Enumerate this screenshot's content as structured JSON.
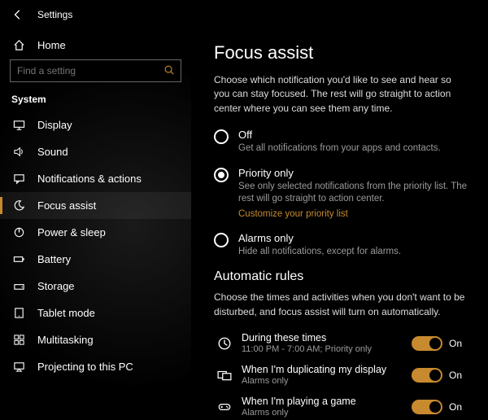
{
  "header": {
    "title": "Settings"
  },
  "sidebar": {
    "home_label": "Home",
    "search_placeholder": "Find a setting",
    "section_label": "System",
    "items": [
      {
        "label": "Display"
      },
      {
        "label": "Sound"
      },
      {
        "label": "Notifications & actions"
      },
      {
        "label": "Focus assist"
      },
      {
        "label": "Power & sleep"
      },
      {
        "label": "Battery"
      },
      {
        "label": "Storage"
      },
      {
        "label": "Tablet mode"
      },
      {
        "label": "Multitasking"
      },
      {
        "label": "Projecting to this PC"
      }
    ]
  },
  "main": {
    "title": "Focus assist",
    "description": "Choose which notification you'd like to see and hear so you can stay focused. The rest will go straight to action center where you can see them any time.",
    "options": [
      {
        "title": "Off",
        "sub": "Get all notifications from your apps and contacts."
      },
      {
        "title": "Priority only",
        "sub": "See only selected notifications from the priority list. The rest will go straight to action center.",
        "link": "Customize your priority list"
      },
      {
        "title": "Alarms only",
        "sub": "Hide all notifications, except for alarms."
      }
    ],
    "auto_title": "Automatic rules",
    "auto_desc": "Choose the times and activities when you don't want to be disturbed, and focus assist will turn on automatically.",
    "rules": [
      {
        "title": "During these times",
        "sub": "11:00 PM - 7:00 AM; Priority only",
        "state": "On"
      },
      {
        "title": "When I'm duplicating my display",
        "sub": "Alarms only",
        "state": "On"
      },
      {
        "title": "When I'm playing a game",
        "sub": "Alarms only",
        "state": "On"
      }
    ]
  },
  "colors": {
    "accent": "#c78a2e"
  }
}
